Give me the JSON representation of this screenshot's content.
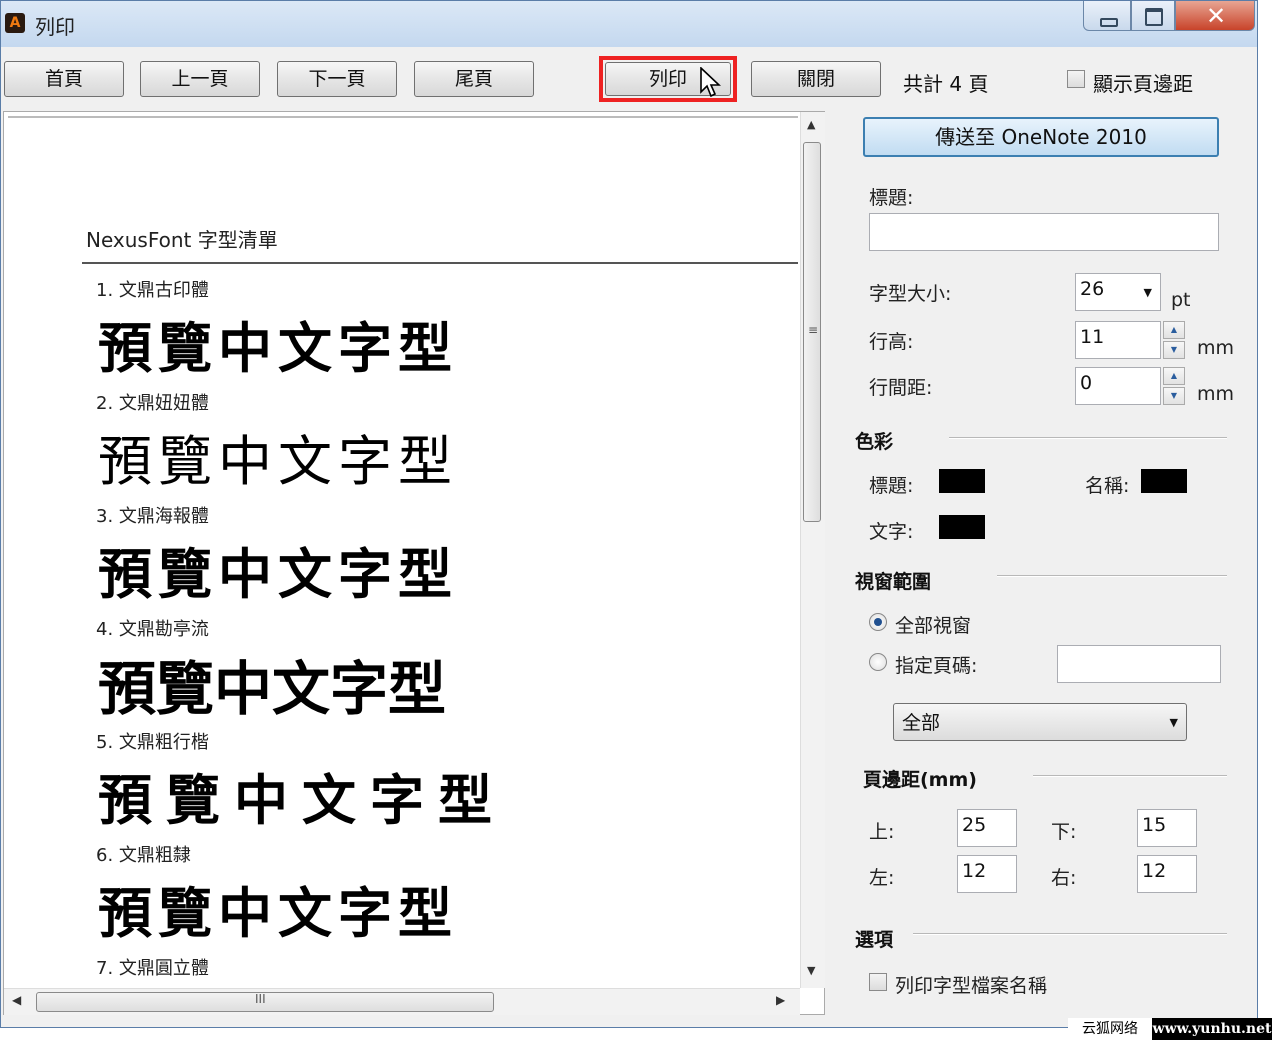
{
  "window": {
    "title": "列印"
  },
  "toolbar": {
    "first_page": "首頁",
    "prev_page": "上一頁",
    "next_page": "下一頁",
    "last_page": "尾頁",
    "print": "列印",
    "close": "關閉",
    "page_count": "共計 4 頁",
    "show_margin": "顯示頁邊距"
  },
  "preview": {
    "doc_title": "NexusFont 字型清單",
    "fonts": [
      {
        "name": "1. 文鼎古印體",
        "sample": "預覽中文字型"
      },
      {
        "name": "2. 文鼎妞妞體",
        "sample": "預覽中文字型"
      },
      {
        "name": "3. 文鼎海報體",
        "sample": "預覽中文字型"
      },
      {
        "name": "4. 文鼎勘亭流",
        "sample": "預覽中文字型"
      },
      {
        "name": "5. 文鼎粗行楷",
        "sample": "預覽中文字型"
      },
      {
        "name": "6. 文鼎粗隸",
        "sample": "預覽中文字型"
      },
      {
        "name": "7. 文鼎圓立體",
        "sample": ""
      }
    ],
    "h_grip": "III",
    "v_grip": "≡"
  },
  "panel": {
    "send_onenote": "傳送至 OneNote 2010",
    "title_label": "標題:",
    "title_value": "",
    "font_size_label": "字型大小:",
    "font_size_value": "26",
    "font_size_unit": "pt",
    "line_height_label": "行高:",
    "line_height_value": "11",
    "line_height_unit": "mm",
    "line_spacing_label": "行間距:",
    "line_spacing_value": "0",
    "line_spacing_unit": "mm",
    "color_section": "色彩",
    "color_title_label": "標題:",
    "color_name_label": "名稱:",
    "color_text_label": "文字:",
    "colors": {
      "title": "#000000",
      "name": "#000000",
      "text": "#000000"
    },
    "range_section": "視窗範圍",
    "range_all": "全部視窗",
    "range_pages": "指定頁碼:",
    "range_pages_value": "",
    "range_select_value": "全部",
    "margin_section": "頁邊距(mm)",
    "margin_top_label": "上:",
    "margin_top": "25",
    "margin_bottom_label": "下:",
    "margin_bottom": "15",
    "margin_left_label": "左:",
    "margin_left": "12",
    "margin_right_label": "右:",
    "margin_right": "12",
    "options_section": "選項",
    "print_filename": "列印字型檔案名稱"
  },
  "watermark": {
    "left": "云狐网络",
    "right": "www.yunhu.net"
  }
}
